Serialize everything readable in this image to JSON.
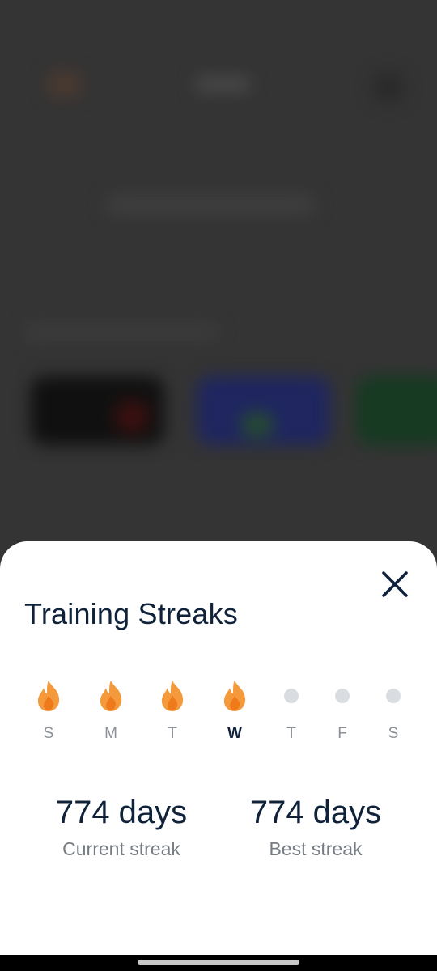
{
  "streak_sheet": {
    "title": "Training Streaks",
    "close_icon": "close-icon",
    "week": [
      {
        "letter": "S",
        "status": "completed",
        "icon": "flame-icon"
      },
      {
        "letter": "M",
        "status": "completed",
        "icon": "flame-icon"
      },
      {
        "letter": "T",
        "status": "completed",
        "icon": "flame-icon"
      },
      {
        "letter": "W",
        "status": "completed",
        "icon": "flame-icon",
        "today": true
      },
      {
        "letter": "T",
        "status": "pending",
        "icon": "dot-icon"
      },
      {
        "letter": "F",
        "status": "pending",
        "icon": "dot-icon"
      },
      {
        "letter": "S",
        "status": "pending",
        "icon": "dot-icon"
      }
    ],
    "current_streak": {
      "value": "774 days",
      "label": "Current streak"
    },
    "best_streak": {
      "value": "774 days",
      "label": "Best streak"
    }
  },
  "colors": {
    "title": "#10223a",
    "flame_outer": "#f59a3c",
    "flame_inner": "#ef7a1c",
    "pending_dot": "#d9dde2",
    "backdrop": "#343434"
  }
}
